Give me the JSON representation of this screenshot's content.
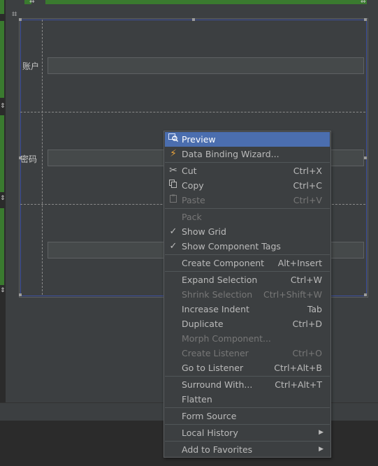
{
  "form": {
    "label_account": "账户",
    "label_password": "密码"
  },
  "menu": {
    "items": [
      {
        "label": "Preview",
        "shortcut": "",
        "icon": "preview-icon",
        "enabled": true,
        "selected": true
      },
      {
        "label": "Data Binding Wizard...",
        "shortcut": "",
        "icon": "lightning-icon",
        "enabled": true
      },
      {
        "label": "Cut",
        "shortcut": "Ctrl+X",
        "icon": "scissors-icon",
        "enabled": true
      },
      {
        "label": "Copy",
        "shortcut": "Ctrl+C",
        "icon": "copy-icon",
        "enabled": true
      },
      {
        "label": "Paste",
        "shortcut": "Ctrl+V",
        "icon": "paste-icon",
        "enabled": false
      },
      {
        "label": "Pack",
        "shortcut": "",
        "enabled": false
      },
      {
        "label": "Show Grid",
        "shortcut": "",
        "icon": "check-icon",
        "enabled": true
      },
      {
        "label": "Show Component Tags",
        "shortcut": "",
        "icon": "check-icon",
        "enabled": true
      },
      {
        "label": "Create Component",
        "shortcut": "Alt+Insert",
        "enabled": true
      },
      {
        "label": "Expand Selection",
        "shortcut": "Ctrl+W",
        "enabled": true
      },
      {
        "label": "Shrink Selection",
        "shortcut": "Ctrl+Shift+W",
        "enabled": false
      },
      {
        "label": "Increase Indent",
        "shortcut": "Tab",
        "enabled": true
      },
      {
        "label": "Duplicate",
        "shortcut": "Ctrl+D",
        "enabled": true
      },
      {
        "label": "Morph Component...",
        "shortcut": "",
        "enabled": false
      },
      {
        "label": "Create Listener",
        "shortcut": "Ctrl+O",
        "enabled": false
      },
      {
        "label": "Go to Listener",
        "shortcut": "Ctrl+Alt+B",
        "enabled": true
      },
      {
        "label": "Surround With...",
        "shortcut": "Ctrl+Alt+T",
        "enabled": true
      },
      {
        "label": "Flatten",
        "shortcut": "",
        "enabled": true
      },
      {
        "label": "Form Source",
        "shortcut": "",
        "enabled": true
      },
      {
        "label": "Local History",
        "shortcut": "",
        "submenu": true,
        "enabled": true
      },
      {
        "label": "Add to Favorites",
        "shortcut": "",
        "submenu": true,
        "enabled": true
      }
    ]
  },
  "colors": {
    "selected": "#4b6eaf",
    "accent_green": "#3a7a2f",
    "lightning": "#e8a33c"
  }
}
